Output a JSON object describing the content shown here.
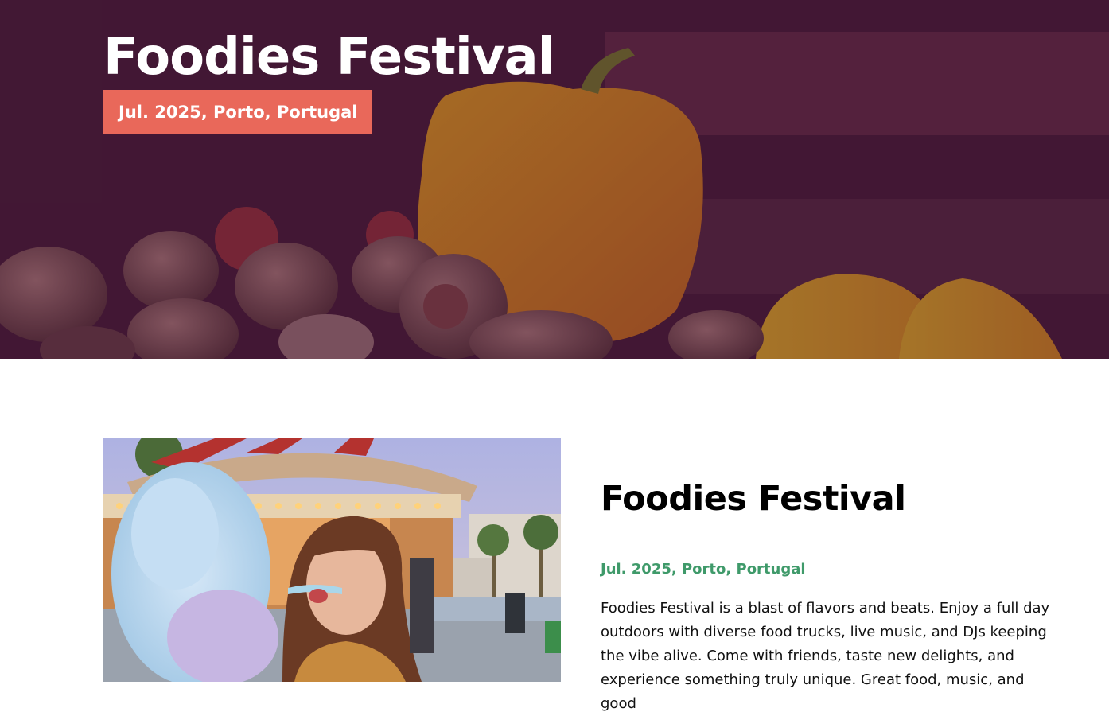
{
  "hero": {
    "title": "Foodies Festival",
    "badge": "Jul. 2025, Porto, Portugal"
  },
  "event": {
    "title": "Foodies Festival",
    "date_location": "Jul. 2025, Porto, Portugal",
    "description": "Foodies Festival is a blast of flavors and beats. Enjoy a full day outdoors with diverse food trucks, live music, and DJs keeping the vibe alive. Come with friends, taste new delights, and experience something truly unique. Great food, music, and good"
  },
  "colors": {
    "badge_background": "#e9685a",
    "date_text": "#3f9a6a",
    "hero_overlay": "#360a30"
  }
}
